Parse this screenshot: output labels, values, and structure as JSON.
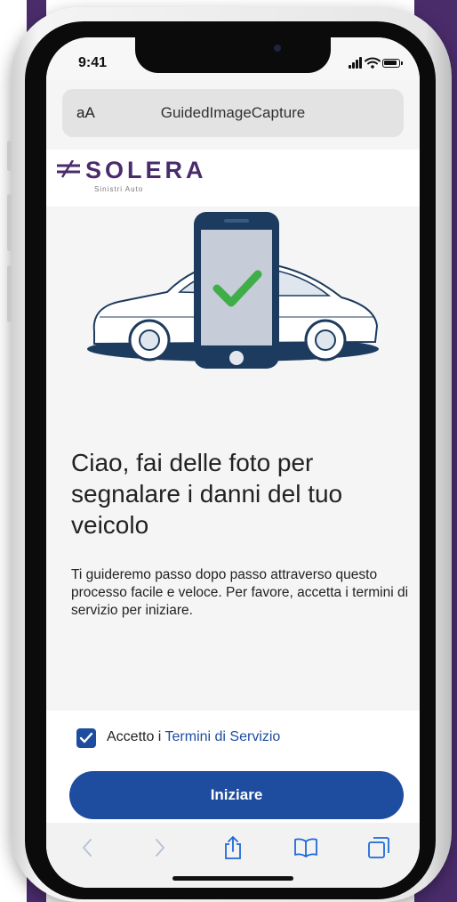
{
  "status_bar": {
    "time": "9:41"
  },
  "browser": {
    "reader_label": "aA",
    "page_title": "GuidedImageCapture"
  },
  "brand": {
    "logo_text": "SOLERA",
    "logo_subtitle": "Sinistri Auto",
    "color": "#4a2c6b"
  },
  "hero": {
    "illustration": "phone-over-car-with-checkmark",
    "check_color": "#3fae49"
  },
  "content": {
    "headline": "Ciao, fai delle foto per segnalare i danni del tuo veicolo",
    "body": "Ti guideremo passo dopo passo attraverso questo processo facile e veloce. Per favore, accetta i termini di servizio per iniziare."
  },
  "terms": {
    "checked": true,
    "prefix": "Accetto i ",
    "link_text": "Termini di Servizio"
  },
  "cta": {
    "label": "Iniziare",
    "color": "#1e4da0"
  },
  "toolbar": {
    "icons": [
      "back-icon",
      "forward-icon",
      "share-icon",
      "bookmarks-icon",
      "tabs-icon"
    ]
  }
}
